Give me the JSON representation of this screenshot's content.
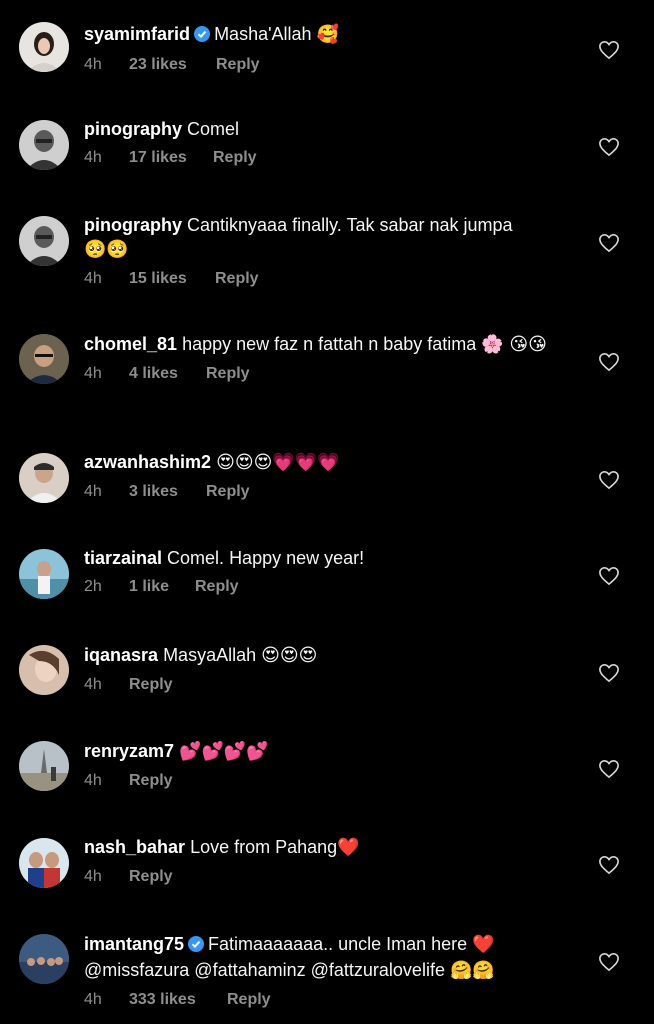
{
  "comments": [
    {
      "user": "syamimfarid",
      "verified": true,
      "text": "Masha'Allah",
      "emoji": "🥰",
      "time": "4h",
      "likes": "23 likes",
      "reply": "Reply"
    },
    {
      "user": "pinography",
      "verified": false,
      "text": "Comel",
      "emoji": "",
      "time": "4h",
      "likes": "17 likes",
      "reply": "Reply"
    },
    {
      "user": "pinography",
      "verified": false,
      "text": "Cantiknyaaa finally. Tak sabar nak jumpa",
      "emoji": "🥺🥺",
      "time": "4h",
      "likes": "15 likes",
      "reply": "Reply"
    },
    {
      "user": "chomel_81",
      "verified": false,
      "text": "happy new faz n fattah n baby fatima",
      "emoji": "🌸 😘😘",
      "time": "4h",
      "likes": "4 likes",
      "reply": "Reply"
    },
    {
      "user": "azwanhashim2",
      "verified": false,
      "text": "",
      "emoji": "😍😍😍💗💗💗",
      "time": "4h",
      "likes": "3 likes",
      "reply": "Reply"
    },
    {
      "user": "tiarzainal",
      "verified": false,
      "text": "Comel. Happy new year!",
      "emoji": "",
      "time": "2h",
      "likes": "1 like",
      "reply": "Reply"
    },
    {
      "user": "iqanasra",
      "verified": false,
      "text": "MasyaAllah",
      "emoji": "😍😍😍",
      "time": "4h",
      "likes": "",
      "reply": "Reply"
    },
    {
      "user": "renryzam7",
      "verified": false,
      "text": "",
      "emoji": "💕💕💕💕",
      "time": "4h",
      "likes": "",
      "reply": "Reply"
    },
    {
      "user": "nash_bahar",
      "verified": false,
      "text": "Love from Pahang",
      "emoji": "❤️",
      "time": "4h",
      "likes": "",
      "reply": "Reply"
    },
    {
      "user": "imantang75",
      "verified": true,
      "text": "Fatimaaaaaaa.. uncle Iman here",
      "emoji": "❤️",
      "line2": "@missfazura @fattahaminz @fattzuralovelife",
      "line2_emoji": "🤗🤗",
      "time": "4h",
      "likes": "333 likes",
      "reply": "Reply"
    }
  ],
  "colors": {
    "background": "#000000",
    "text": "#ffffff",
    "meta": "#8e8e8e",
    "verified": "#3897f0"
  },
  "icons": {
    "like": "heart-outline-icon",
    "verified": "verified-badge-icon"
  }
}
